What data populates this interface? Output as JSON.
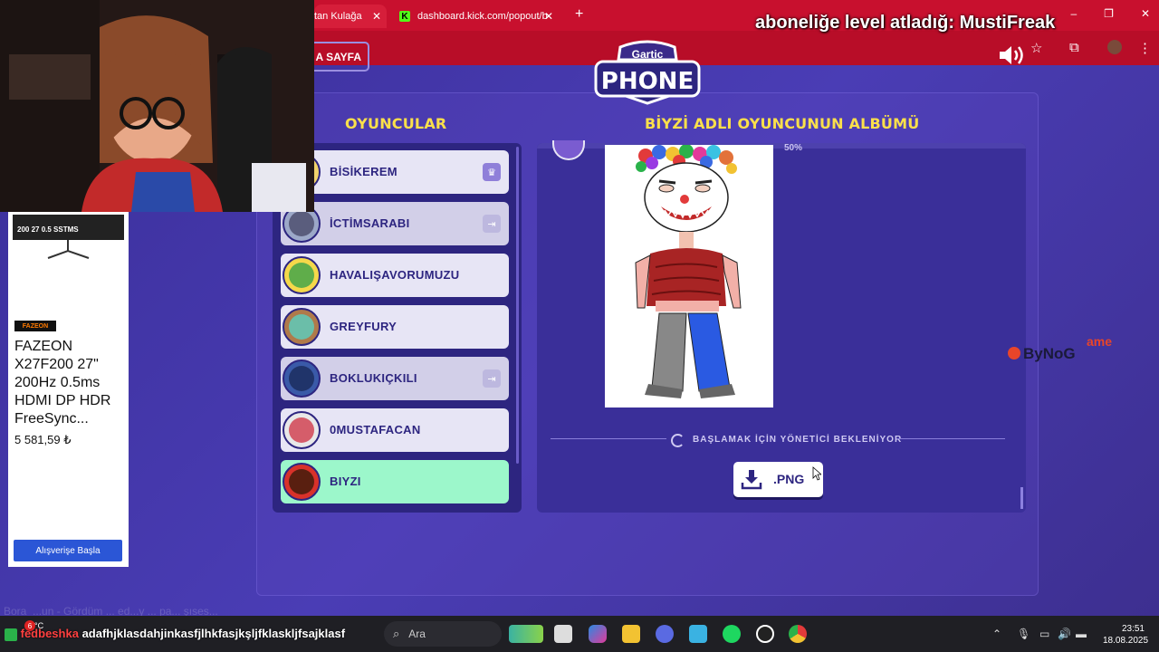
{
  "browser": {
    "tabs": [
      {
        "label": "tan Kulağa",
        "active": true
      },
      {
        "label": "dashboard.kick.com/popout/b",
        "active": false
      }
    ],
    "new_tab_symbol": "+",
    "window_controls": [
      "‒",
      "❐",
      "✕"
    ]
  },
  "stream_overlay": {
    "alert_text": "aboneliğe level atladığ: MustiFreak"
  },
  "game": {
    "back_button": "A SAYFA",
    "logo_top": "Gartic",
    "logo_bottom": "PHONE",
    "players_heading": "OYUNCULAR",
    "album_heading": "BİYZİ ADLI OYUNCUNUN ALBÜMÜ",
    "players": [
      {
        "name": "BİSİKEREM",
        "badge": "crown-icon",
        "state": "normal"
      },
      {
        "name": "İCTİMSARABI",
        "badge": "exit-icon",
        "state": "dim"
      },
      {
        "name": "HAVALIŞAVORUMUZU",
        "badge": "",
        "state": "normal"
      },
      {
        "name": "GREYFURY",
        "badge": "",
        "state": "normal"
      },
      {
        "name": "BOKLUKIÇKILI",
        "badge": "exit-icon",
        "state": "dim"
      },
      {
        "name": "0MUSTAFACAN",
        "badge": "",
        "state": "normal"
      },
      {
        "name": "BIYZI",
        "badge": "",
        "state": "active"
      }
    ],
    "progress_label": "50%",
    "waiting_text": "BAŞLAMAK İÇİN YÖNETİCİ BEKLENİYOR",
    "download_label": ".PNG",
    "watermark": "ByNoG",
    "watermark_suffix": "ame"
  },
  "ad": {
    "monitor_stats": "200  27  0.5  SSTMS",
    "brand": "FAZEON",
    "title": "FAZEON X27F200 27\" 200Hz 0.5ms HDMI DP HDR FreeSync...",
    "price": "5 581,59 ₺",
    "button": "Alışverişe Başla"
  },
  "chat_faded": "Bora_...un - Gördüm ... ed...y ... pa... şıses...",
  "ticker": {
    "user": "fedbeshka",
    "message": "adafhjklasdahjinkasfjlhkfasjkşljfklaskljfsajklasf",
    "badge_count": "6"
  },
  "taskbar": {
    "weather": "23°C",
    "search_placeholder": "Ara",
    "time": "23:51",
    "date": "18.08.2025"
  },
  "colors": {
    "accent_yellow": "#fbe04a",
    "panel_dark": "#2d2580",
    "active_player": "#9cf7cb",
    "browser_red": "#c8102e"
  }
}
